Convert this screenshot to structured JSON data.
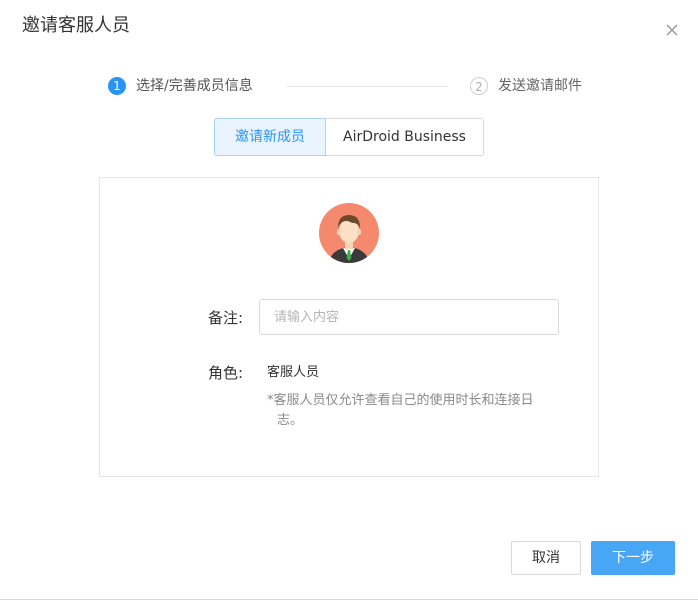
{
  "dialog": {
    "title": "邀请客服人员",
    "close_icon": "close-icon"
  },
  "steps": [
    {
      "number": "1",
      "label": "选择/完善成员信息",
      "active": true
    },
    {
      "number": "2",
      "label": "发送邀请邮件",
      "active": false
    }
  ],
  "tabs": [
    {
      "label": "邀请新成员",
      "active": true
    },
    {
      "label": "AirDroid Business",
      "active": false
    }
  ],
  "form": {
    "avatar_icon": "user-avatar-icon",
    "note_label": "备注:",
    "note_placeholder": "请输入内容",
    "note_value": "",
    "role_label": "角色:",
    "role_value": "客服人员",
    "role_hint_line1": "*客服人员仅允许查看自己的使用时长和连接日",
    "role_hint_line2": "志。"
  },
  "footer": {
    "cancel_label": "取消",
    "next_label": "下一步"
  },
  "colors": {
    "accent": "#2a94f4",
    "primary_button": "#47a6f6",
    "active_tab_bg": "#e9f4fe",
    "avatar_bg": "#f4896e"
  }
}
